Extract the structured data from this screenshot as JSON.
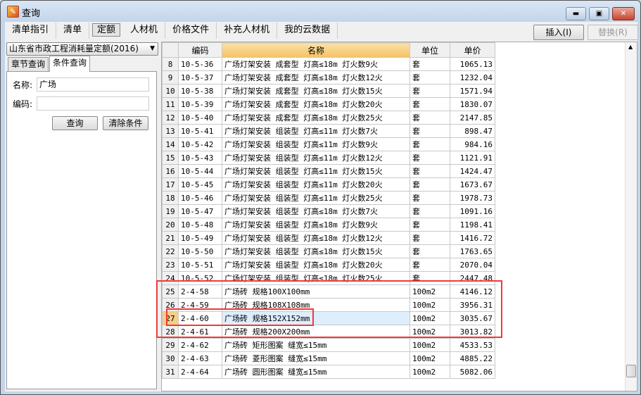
{
  "window": {
    "title": "查询",
    "controls": [
      "minimize",
      "maximize",
      "close"
    ]
  },
  "toolbar": {
    "tabs": [
      "清单指引",
      "清单",
      "定额",
      "人材机",
      "价格文件",
      "补充人材机",
      "我的云数据"
    ],
    "active_tab": "定额",
    "insert_label": "插入(I)",
    "replace_label": "替换(R)"
  },
  "left": {
    "quota_select": "山东省市政工程消耗量定额(2016)",
    "tabs": [
      "章节查询",
      "条件查询"
    ],
    "active_tab": "条件查询",
    "name_label": "名称:",
    "name_value": "广场",
    "code_label": "编码:",
    "code_value": "",
    "search_label": "查询",
    "clear_label": "清除条件"
  },
  "grid": {
    "columns": [
      "",
      "编码",
      "名称",
      "单位",
      "单价"
    ],
    "sorted_column": "名称",
    "selected_row": "27",
    "rows": [
      [
        "8",
        "10-5-36",
        "广场灯架安装 成套型 灯高≤18m 灯火数9火",
        "套",
        "1065.13"
      ],
      [
        "9",
        "10-5-37",
        "广场灯架安装 成套型 灯高≤18m 灯火数12火",
        "套",
        "1232.04"
      ],
      [
        "10",
        "10-5-38",
        "广场灯架安装 成套型 灯高≤18m 灯火数15火",
        "套",
        "1571.94"
      ],
      [
        "11",
        "10-5-39",
        "广场灯架安装 成套型 灯高≤18m 灯火数20火",
        "套",
        "1830.07"
      ],
      [
        "12",
        "10-5-40",
        "广场灯架安装 成套型 灯高≤18m 灯火数25火",
        "套",
        "2147.85"
      ],
      [
        "13",
        "10-5-41",
        "广场灯架安装 组装型 灯高≤11m 灯火数7火",
        "套",
        "898.47"
      ],
      [
        "14",
        "10-5-42",
        "广场灯架安装 组装型 灯高≤11m 灯火数9火",
        "套",
        "984.16"
      ],
      [
        "15",
        "10-5-43",
        "广场灯架安装 组装型 灯高≤11m 灯火数12火",
        "套",
        "1121.91"
      ],
      [
        "16",
        "10-5-44",
        "广场灯架安装 组装型 灯高≤11m 灯火数15火",
        "套",
        "1424.47"
      ],
      [
        "17",
        "10-5-45",
        "广场灯架安装 组装型 灯高≤11m 灯火数20火",
        "套",
        "1673.67"
      ],
      [
        "18",
        "10-5-46",
        "广场灯架安装 组装型 灯高≤11m 灯火数25火",
        "套",
        "1978.73"
      ],
      [
        "19",
        "10-5-47",
        "广场灯架安装 组装型 灯高≤18m 灯火数7火",
        "套",
        "1091.16"
      ],
      [
        "20",
        "10-5-48",
        "广场灯架安装 组装型 灯高≤18m 灯火数9火",
        "套",
        "1198.41"
      ],
      [
        "21",
        "10-5-49",
        "广场灯架安装 组装型 灯高≤18m 灯火数12火",
        "套",
        "1416.72"
      ],
      [
        "22",
        "10-5-50",
        "广场灯架安装 组装型 灯高≤18m 灯火数15火",
        "套",
        "1763.65"
      ],
      [
        "23",
        "10-5-51",
        "广场灯架安装 组装型 灯高≤18m 灯火数20火",
        "套",
        "2070.04"
      ],
      [
        "24",
        "10-5-52",
        "广场灯架安装 组装型 灯高≤18m 灯火数25火",
        "套",
        "2447.48"
      ],
      [
        "25",
        "2-4-58",
        "广场砖 规格100X100mm",
        "100m2",
        "4146.12"
      ],
      [
        "26",
        "2-4-59",
        "广场砖 规格108X108mm",
        "100m2",
        "3956.31"
      ],
      [
        "27",
        "2-4-60",
        "广场砖 规格152X152mm",
        "100m2",
        "3035.67"
      ],
      [
        "28",
        "2-4-61",
        "广场砖 规格200X200mm",
        "100m2",
        "3013.82"
      ],
      [
        "29",
        "2-4-62",
        "广场砖 矩形图案 缝宽≤15mm",
        "100m2",
        "4533.53"
      ],
      [
        "30",
        "2-4-63",
        "广场砖 菱形图案 缝宽≤15mm",
        "100m2",
        "4885.22"
      ],
      [
        "31",
        "2-4-64",
        "广场砖 圆形图案 缝宽≤15mm",
        "100m2",
        "5082.06"
      ]
    ]
  },
  "annotation_color": "#f03a3a"
}
